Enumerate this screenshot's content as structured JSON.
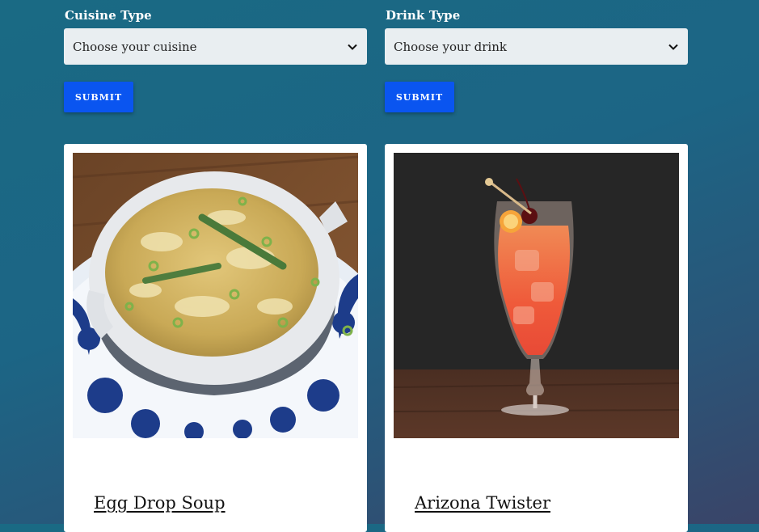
{
  "cuisine": {
    "label": "Cuisine Type",
    "select_value": "Choose your cuisine",
    "submit_label": "SUBMIT",
    "card_title": "Egg Drop Soup"
  },
  "drink": {
    "label": "Drink Type",
    "select_value": "Choose your drink",
    "submit_label": "SUBMIT",
    "card_title": "Arizona Twister"
  },
  "colors": {
    "submit_button": "#0a55f0",
    "select_bg": "#e9eef1",
    "background_top": "#1a6a84",
    "background_bottom": "#3a4468"
  },
  "icons": {
    "select_chevron": "chevron-down-icon"
  }
}
